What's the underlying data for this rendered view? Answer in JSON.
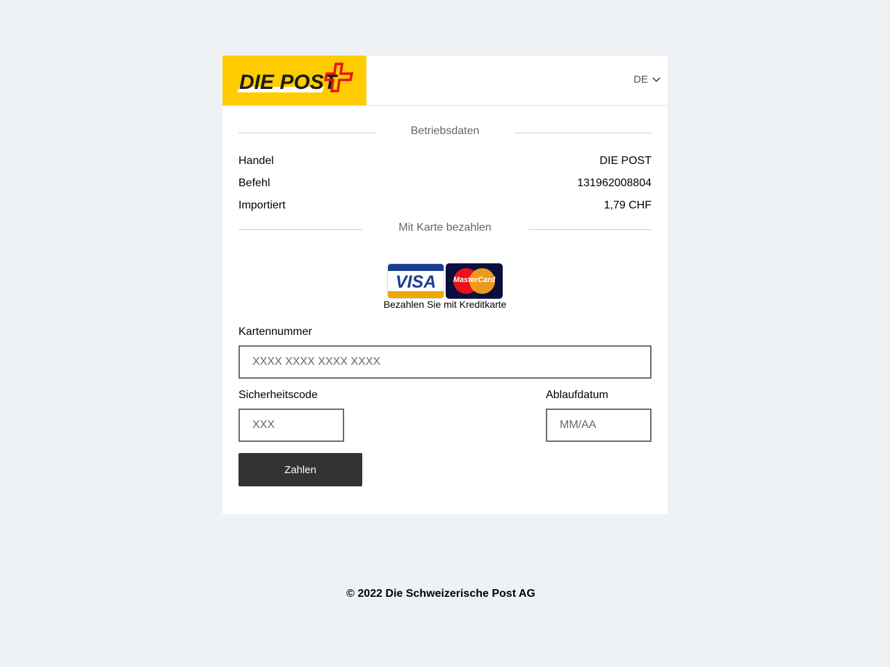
{
  "header": {
    "logo_text": "DIE POST",
    "language": "DE",
    "brand_color": "#ffcc00"
  },
  "operating_data": {
    "title": "Betriebsdaten",
    "rows": [
      {
        "label": "Handel",
        "value": "DIE POST"
      },
      {
        "label": "Befehl",
        "value": "131962008804"
      },
      {
        "label": "Importiert",
        "value": "1,79 CHF"
      }
    ]
  },
  "payment": {
    "title": "Mit Karte bezahlen",
    "card_brands": [
      "VISA",
      "MasterCard"
    ],
    "cards_caption": "Bezahlen Sie mit Kreditkarte",
    "card_number_label": "Kartennummer",
    "card_number_placeholder": "XXXX XXXX XXXX XXXX",
    "security_code_label": "Sicherheitscode",
    "security_code_placeholder": "XXX",
    "expiry_label": "Ablaufdatum",
    "expiry_placeholder": "MM/AA",
    "pay_button": "Zahlen"
  },
  "footer": {
    "copyright": "© 2022 Die Schweizerische Post AG"
  }
}
